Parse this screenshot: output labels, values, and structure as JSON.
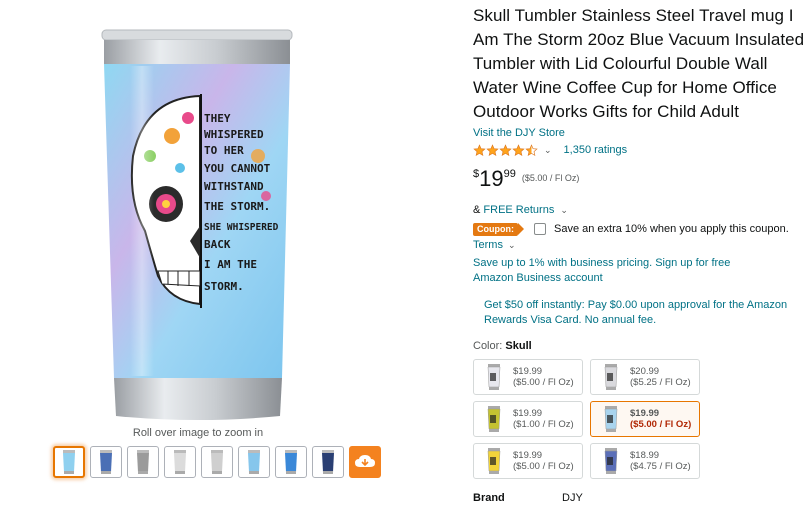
{
  "colors": {
    "link": "#007185",
    "price_red": "#b12704",
    "accent_orange": "#e47911",
    "star": "#ffa41c"
  },
  "gallery": {
    "zoom_hint": "Roll over image to zoom in",
    "tumbler_text_lines": [
      "THEY",
      "WHISPERED",
      "TO HER",
      "YOU CANNOT",
      "WITHSTAND",
      "THE STORM.",
      "SHE WHISPERED",
      "BACK",
      "I AM THE",
      "STORM."
    ],
    "thumbnails": [
      {
        "icon": "tumbler-blue",
        "active": true
      },
      {
        "icon": "tumbler-flowers",
        "active": false
      },
      {
        "icon": "tumbler-lid",
        "active": false
      },
      {
        "icon": "tumbler-accessories",
        "active": false
      },
      {
        "icon": "tumbler-parts",
        "active": false
      },
      {
        "icon": "tumbler-side",
        "active": false
      },
      {
        "icon": "tumbler-collage",
        "active": false
      },
      {
        "icon": "tumbler-dark",
        "active": false
      },
      {
        "icon": "video-icon",
        "active": false
      }
    ]
  },
  "product": {
    "title": "Skull Tumbler Stainless Steel Travel mug I Am The Storm 20oz Blue Vacuum Insulated Tumbler with Lid Colourful Double Wall Water Wine Coffee Cup for Home Office Outdoor Works Gifts for Child Adult",
    "store_link": "Visit the DJY Store",
    "rating": 4.5,
    "ratings_count": "1,350 ratings",
    "price": {
      "symbol": "$",
      "whole": "19",
      "fraction": "99",
      "unit": "($5.00 / Fl Oz)"
    },
    "returns_prefix": "&",
    "returns": "FREE Returns",
    "coupon_badge": "Coupon:",
    "coupon_text": "Save an extra 10% when you apply this coupon.",
    "terms": "Terms",
    "business": "Save up to 1% with business pricing. Sign up for free Amazon Business account",
    "visa_offer": "Get $50 off instantly: Pay $0.00 upon approval for the Amazon Rewards Visa Card. No annual fee.",
    "color_label": "Color:",
    "color_value": "Skull",
    "swatches": [
      {
        "price": "$19.99",
        "unit": "($5.00 / Fl Oz)",
        "tint": "#e8e8ee",
        "selected": false
      },
      {
        "price": "$20.99",
        "unit": "($5.25 / Fl Oz)",
        "tint": "#d9d9dd",
        "selected": false
      },
      {
        "price": "$19.99",
        "unit": "($1.00 / Fl Oz)",
        "tint": "#c4c231",
        "selected": false
      },
      {
        "price": "$19.99",
        "unit": "($5.00 / Fl Oz)",
        "tint": "#a9d4ee",
        "selected": true
      },
      {
        "price": "$19.99",
        "unit": "($5.00 / Fl Oz)",
        "tint": "#f2d43a",
        "selected": false
      },
      {
        "price": "$18.99",
        "unit": "($4.75 / Fl Oz)",
        "tint": "#5b6fb8",
        "selected": false
      }
    ],
    "brand_label": "Brand",
    "brand_value": "DJY"
  }
}
